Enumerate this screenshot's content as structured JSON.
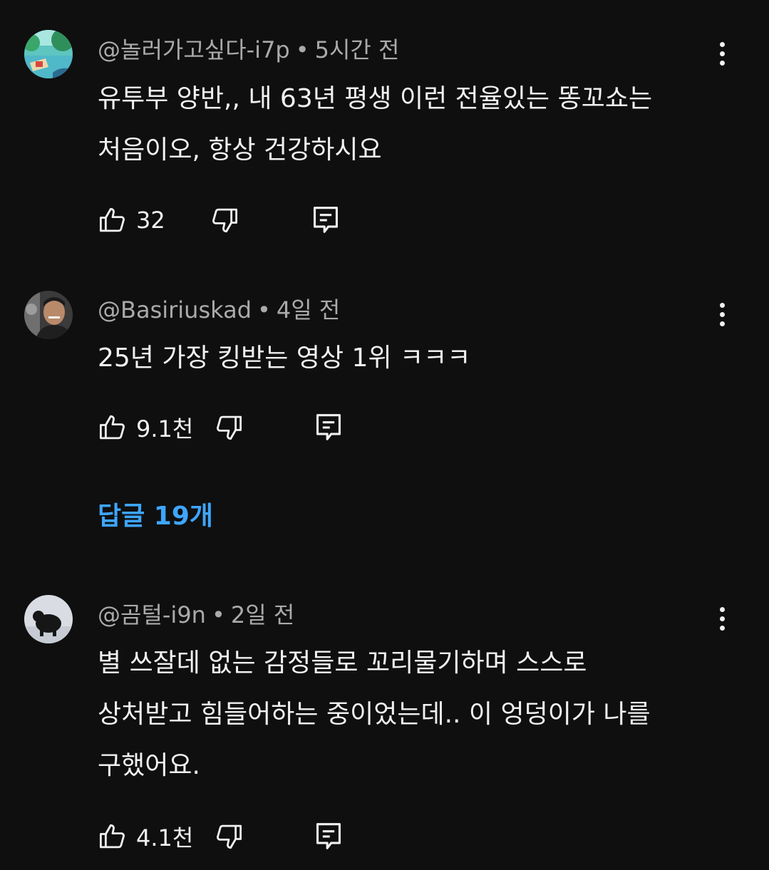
{
  "comments": [
    {
      "author": "@놀러가고싶다-i7p",
      "time": "5시간 전",
      "lines": [
        "유투부 양반,, 내 63년 평생 이런 전율있는 똥꼬쇼는",
        "처음이오, 항상 건강하시요"
      ],
      "likes": "32"
    },
    {
      "author": "@Basiriuskad",
      "time": "4일 전",
      "lines": [
        "25년 가장 킹받는 영상 1위 ㅋㅋㅋ"
      ],
      "likes": "9.1천",
      "replies_label": "답글 19개"
    },
    {
      "author": "@곰털-i9n",
      "time": "2일 전",
      "lines": [
        "별 쓰잘데 없는 감정들로 꼬리물기하며 스스로",
        "상처받고 힘들어하는 중이었는데.. 이 엉덩이가 나를",
        "구했어요."
      ],
      "likes": "4.1천"
    }
  ],
  "separator": "•",
  "icons": {
    "like": "thumbs-up-icon",
    "dislike": "thumbs-down-icon",
    "reply": "reply-comment-icon",
    "more": "more-vertical-icon"
  },
  "colors": {
    "background": "#0f0f0f",
    "text": "#f1f1f1",
    "meta": "#aaaaaa",
    "link": "#3ea6ff"
  }
}
